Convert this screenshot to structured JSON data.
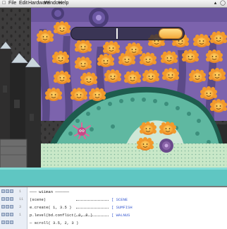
{
  "menubar": {
    "items": [
      "File",
      "Edit",
      "Hardware",
      "Window",
      "Help"
    ],
    "apple_icon": "apple-icon",
    "status_icons": [
      "speaker-icon",
      "clock-icon"
    ]
  },
  "game": {
    "hud": {
      "progress": 0.21,
      "marker_position": 0.4
    },
    "colors": {
      "sky": "#3f3e3e",
      "purple_band": "#8b6fb8",
      "tentacle": "#5b4a88",
      "jelly": "#f7a936",
      "jelly_face": "#fcd163",
      "reef": "#5fb8a1",
      "reef_dark": "#1e5c4e",
      "floor": "#c9e8c8",
      "water": "#5fc6c2",
      "rock": "#2a2a2a",
      "crystal": "#c9d5dc",
      "hud_fill": "#f3a93a",
      "anemone": "#e0659c",
      "urchin": "#8a64a8"
    },
    "entities": [
      "jellyfish",
      "reef-creature",
      "anemone",
      "urchin",
      "crystal-towers"
    ]
  },
  "editor": {
    "lines": [
      {
        "num": "1",
        "code": "――― wiiman ――――――",
        "comment": "",
        "dashes": false
      },
      {
        "num": "11",
        "code": "(scene)",
        "comment": "[ SCENE",
        "dashes": true
      },
      {
        "num": "3",
        "code": "e.create( 1, 3.5 )",
        "comment": "[ SUMFISH",
        "dashes": true
      },
      {
        "num": "1",
        "code": "p.level(bd.conflict( 0, 8 )",
        "comment": "[ WALNUS",
        "dashes": true
      },
      {
        "num": "",
        "code": "― scroll( 3.5, 2, 3 )",
        "comment": "",
        "dashes": false
      }
    ]
  }
}
